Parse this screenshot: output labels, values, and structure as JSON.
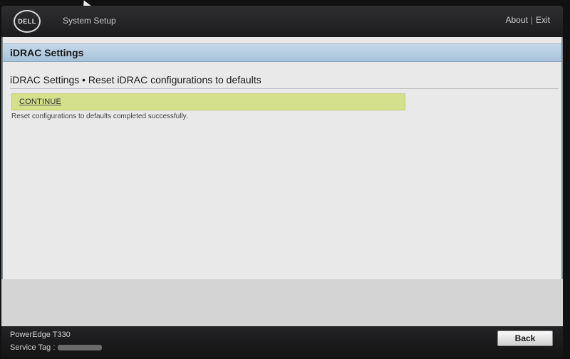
{
  "header": {
    "logo_text": "DELL",
    "app_title": "System Setup",
    "links": {
      "about": "About",
      "separator": "|",
      "exit": "Exit"
    }
  },
  "section": {
    "title": "iDRAC Settings"
  },
  "page": {
    "heading": "iDRAC Settings • Reset iDRAC configurations to defaults",
    "continue_label": "CONTINUE",
    "status_message": "Reset configurations to defaults completed successfully."
  },
  "footer": {
    "model": "PowerEdge T330",
    "service_tag_label": "Service Tag :",
    "back_label": "Back"
  },
  "colors": {
    "continue_highlight": "#d5e08a",
    "section_bar": "#b5cce0"
  }
}
